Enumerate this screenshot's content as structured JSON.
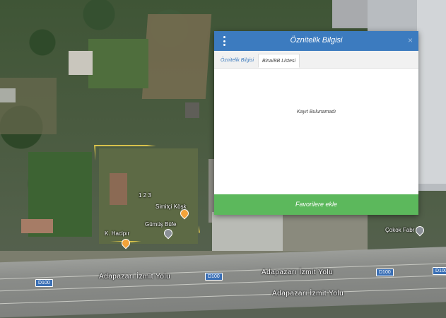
{
  "map": {
    "roads": [
      {
        "label": "Adapazarı İzmit Yolu"
      },
      {
        "label": "Adapazarı İzmit Yolu"
      },
      {
        "label": "Adapazarı İzmit Yolu"
      }
    ],
    "route_badges": [
      "D100",
      "D100",
      "D100",
      "D100"
    ],
    "places": [
      {
        "label": "Simitçi Köşk",
        "icon": "pin-orange-icon"
      },
      {
        "label": "Gümüş Büfe",
        "icon": "pin-gray-icon"
      },
      {
        "label": "K. Hacipır",
        "icon": "pin-orange-icon"
      },
      {
        "label": "Çokok Fabr",
        "icon": "pin-gray-icon"
      }
    ],
    "parcel_label": "1 2 3"
  },
  "dialog": {
    "title": "Öznitelik Bilgisi",
    "menu_icon": "kebab-menu-icon",
    "close_icon": "close-icon",
    "close_glyph": "×",
    "tabs": [
      {
        "label": "Öznitelik Bilgisi",
        "active": false
      },
      {
        "label": "Bina/BB Listesi",
        "active": true
      }
    ],
    "empty_message": "Kayıt Bulunamadı",
    "footer_button": "Favorilere ekle",
    "colors": {
      "header": "#3c7bbf",
      "footer": "#5cb85c"
    }
  }
}
